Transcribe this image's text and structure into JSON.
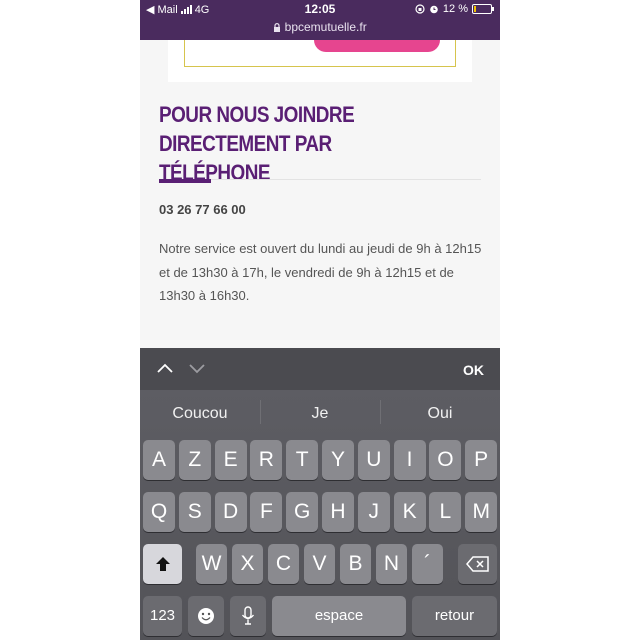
{
  "status_bar": {
    "carrier": "◀ Mail",
    "network": "4G",
    "time": "12:05",
    "battery": "12 %",
    "battery_level": 0.12,
    "url": "bpcemutuelle.fr"
  },
  "section": {
    "title": "POUR NOUS JOINDRE DIRECTEMENT PAR TÉLÉPHONE",
    "phone": "03 26 77 66 00",
    "hours": "Notre service est ouvert du lundi au jeudi de 9h à 12h15 et de 13h30 à 17h, le vendredi de 9h à 12h15 et de 13h30 à 16h30."
  },
  "accessory": {
    "done_label": "OK"
  },
  "suggestions": [
    "Coucou",
    "Je",
    "Oui"
  ],
  "keys": {
    "row1": [
      "A",
      "Z",
      "E",
      "R",
      "T",
      "Y",
      "U",
      "I",
      "O",
      "P"
    ],
    "row2": [
      "Q",
      "S",
      "D",
      "F",
      "G",
      "H",
      "J",
      "K",
      "L",
      "M"
    ],
    "row3": [
      "W",
      "X",
      "C",
      "V",
      "B",
      "N",
      "´"
    ],
    "numbers_label": "123",
    "space_label": "espace",
    "return_label": "retour"
  },
  "colors": {
    "brand_purple": "#5a1f74",
    "status_bar": "#4a2b5e",
    "accent_pink": "#e6458f"
  },
  "icons": [
    "lock-icon",
    "orientation-lock-icon",
    "alarm-icon",
    "battery-icon",
    "chevron-up-icon",
    "chevron-down-icon",
    "shift-icon",
    "delete-icon",
    "emoji-icon",
    "microphone-icon"
  ]
}
